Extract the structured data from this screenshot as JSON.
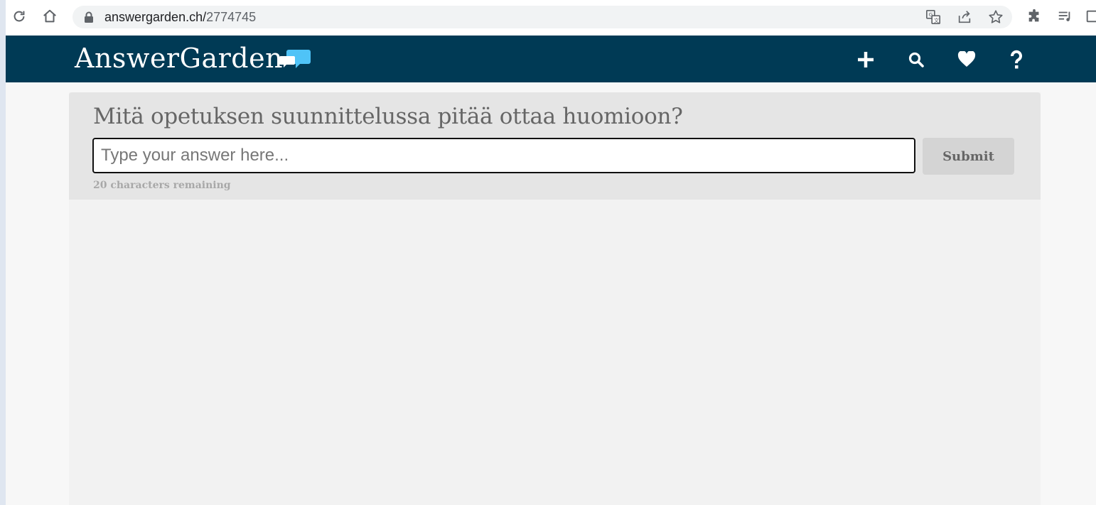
{
  "browser": {
    "url_host": "answergarden.ch/",
    "url_path": "2774745",
    "icons": [
      "reload-icon",
      "home-icon",
      "lock-icon",
      "translate-icon",
      "share-icon",
      "bookmark-star-icon",
      "extensions-icon",
      "reading-list-icon",
      "side-panel-icon"
    ]
  },
  "header": {
    "logo_text": "AnswerGarden",
    "nav": [
      {
        "name": "create-icon",
        "glyph": "+"
      },
      {
        "name": "search-icon",
        "glyph": "search"
      },
      {
        "name": "favorite-icon",
        "glyph": "heart"
      },
      {
        "name": "help-icon",
        "glyph": "?"
      }
    ]
  },
  "main": {
    "question": "Mitä opetuksen suunnittelussa pitää ottaa huomioon?",
    "input_placeholder": "Type your answer here...",
    "input_value": "",
    "submit_label": "Submit",
    "remaining_text": "20 characters remaining"
  },
  "colors": {
    "header_bg": "#003a55",
    "logo_accent": "#4fc3f7"
  }
}
